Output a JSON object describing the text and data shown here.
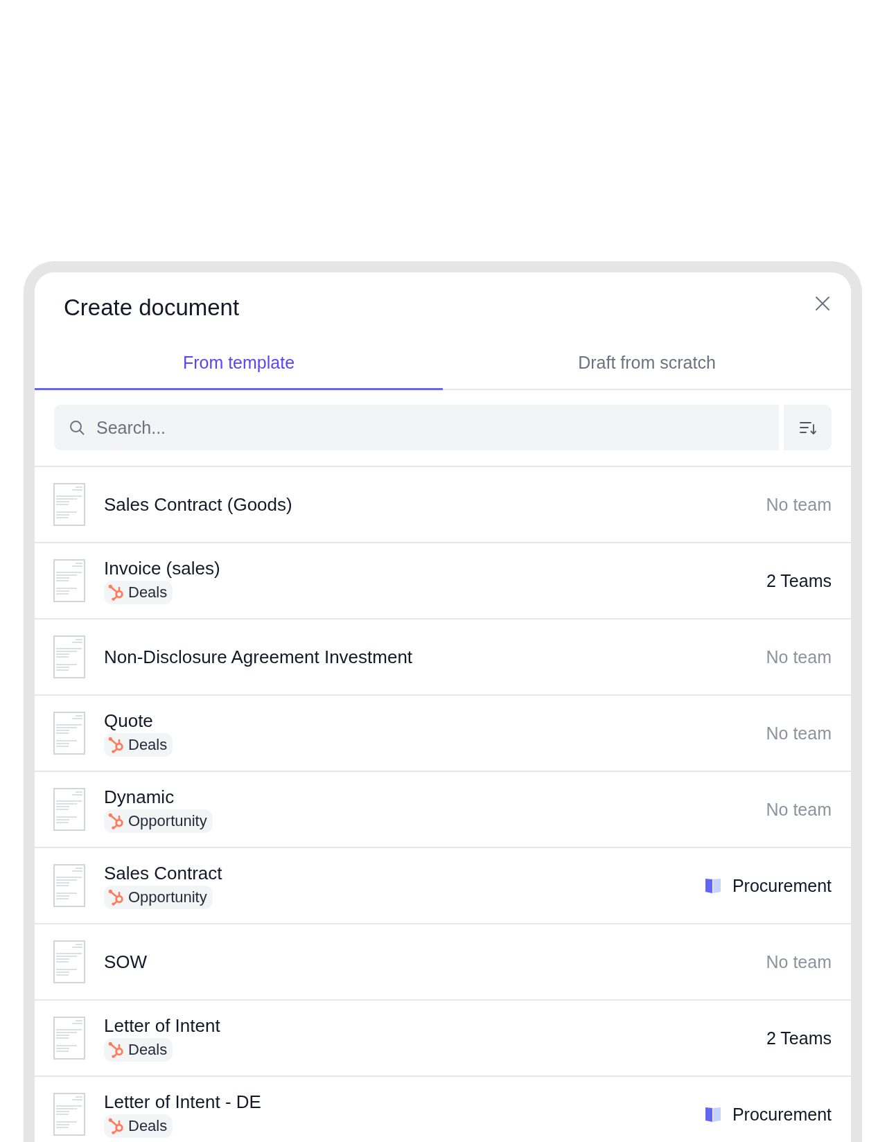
{
  "dialog": {
    "title": "Create document",
    "tabs": [
      {
        "label": "From template",
        "selected": true
      },
      {
        "label": "Draft from scratch",
        "selected": false
      }
    ],
    "search": {
      "placeholder": "Search..."
    },
    "templates": [
      {
        "name": "Sales Contract (Goods)",
        "team": {
          "kind": "none",
          "label": "No team"
        }
      },
      {
        "name": "Invoice (sales)",
        "tag": "Deals",
        "team": {
          "kind": "count",
          "label": "2 Teams"
        }
      },
      {
        "name": "Non-Disclosure Agreement Investment",
        "team": {
          "kind": "none",
          "label": "No team"
        }
      },
      {
        "name": "Quote",
        "tag": "Deals",
        "team": {
          "kind": "none",
          "label": "No team"
        }
      },
      {
        "name": "Dynamic",
        "tag": "Opportunity",
        "team": {
          "kind": "none",
          "label": "No team"
        }
      },
      {
        "name": "Sales Contract",
        "tag": "Opportunity",
        "team": {
          "kind": "team",
          "label": "Procurement"
        }
      },
      {
        "name": "SOW",
        "team": {
          "kind": "none",
          "label": "No team"
        }
      },
      {
        "name": "Letter of Intent",
        "tag": "Deals",
        "team": {
          "kind": "count",
          "label": "2 Teams"
        }
      },
      {
        "name": "Letter of Intent - DE",
        "tag": "Deals",
        "team": {
          "kind": "team",
          "label": "Procurement"
        }
      }
    ]
  }
}
